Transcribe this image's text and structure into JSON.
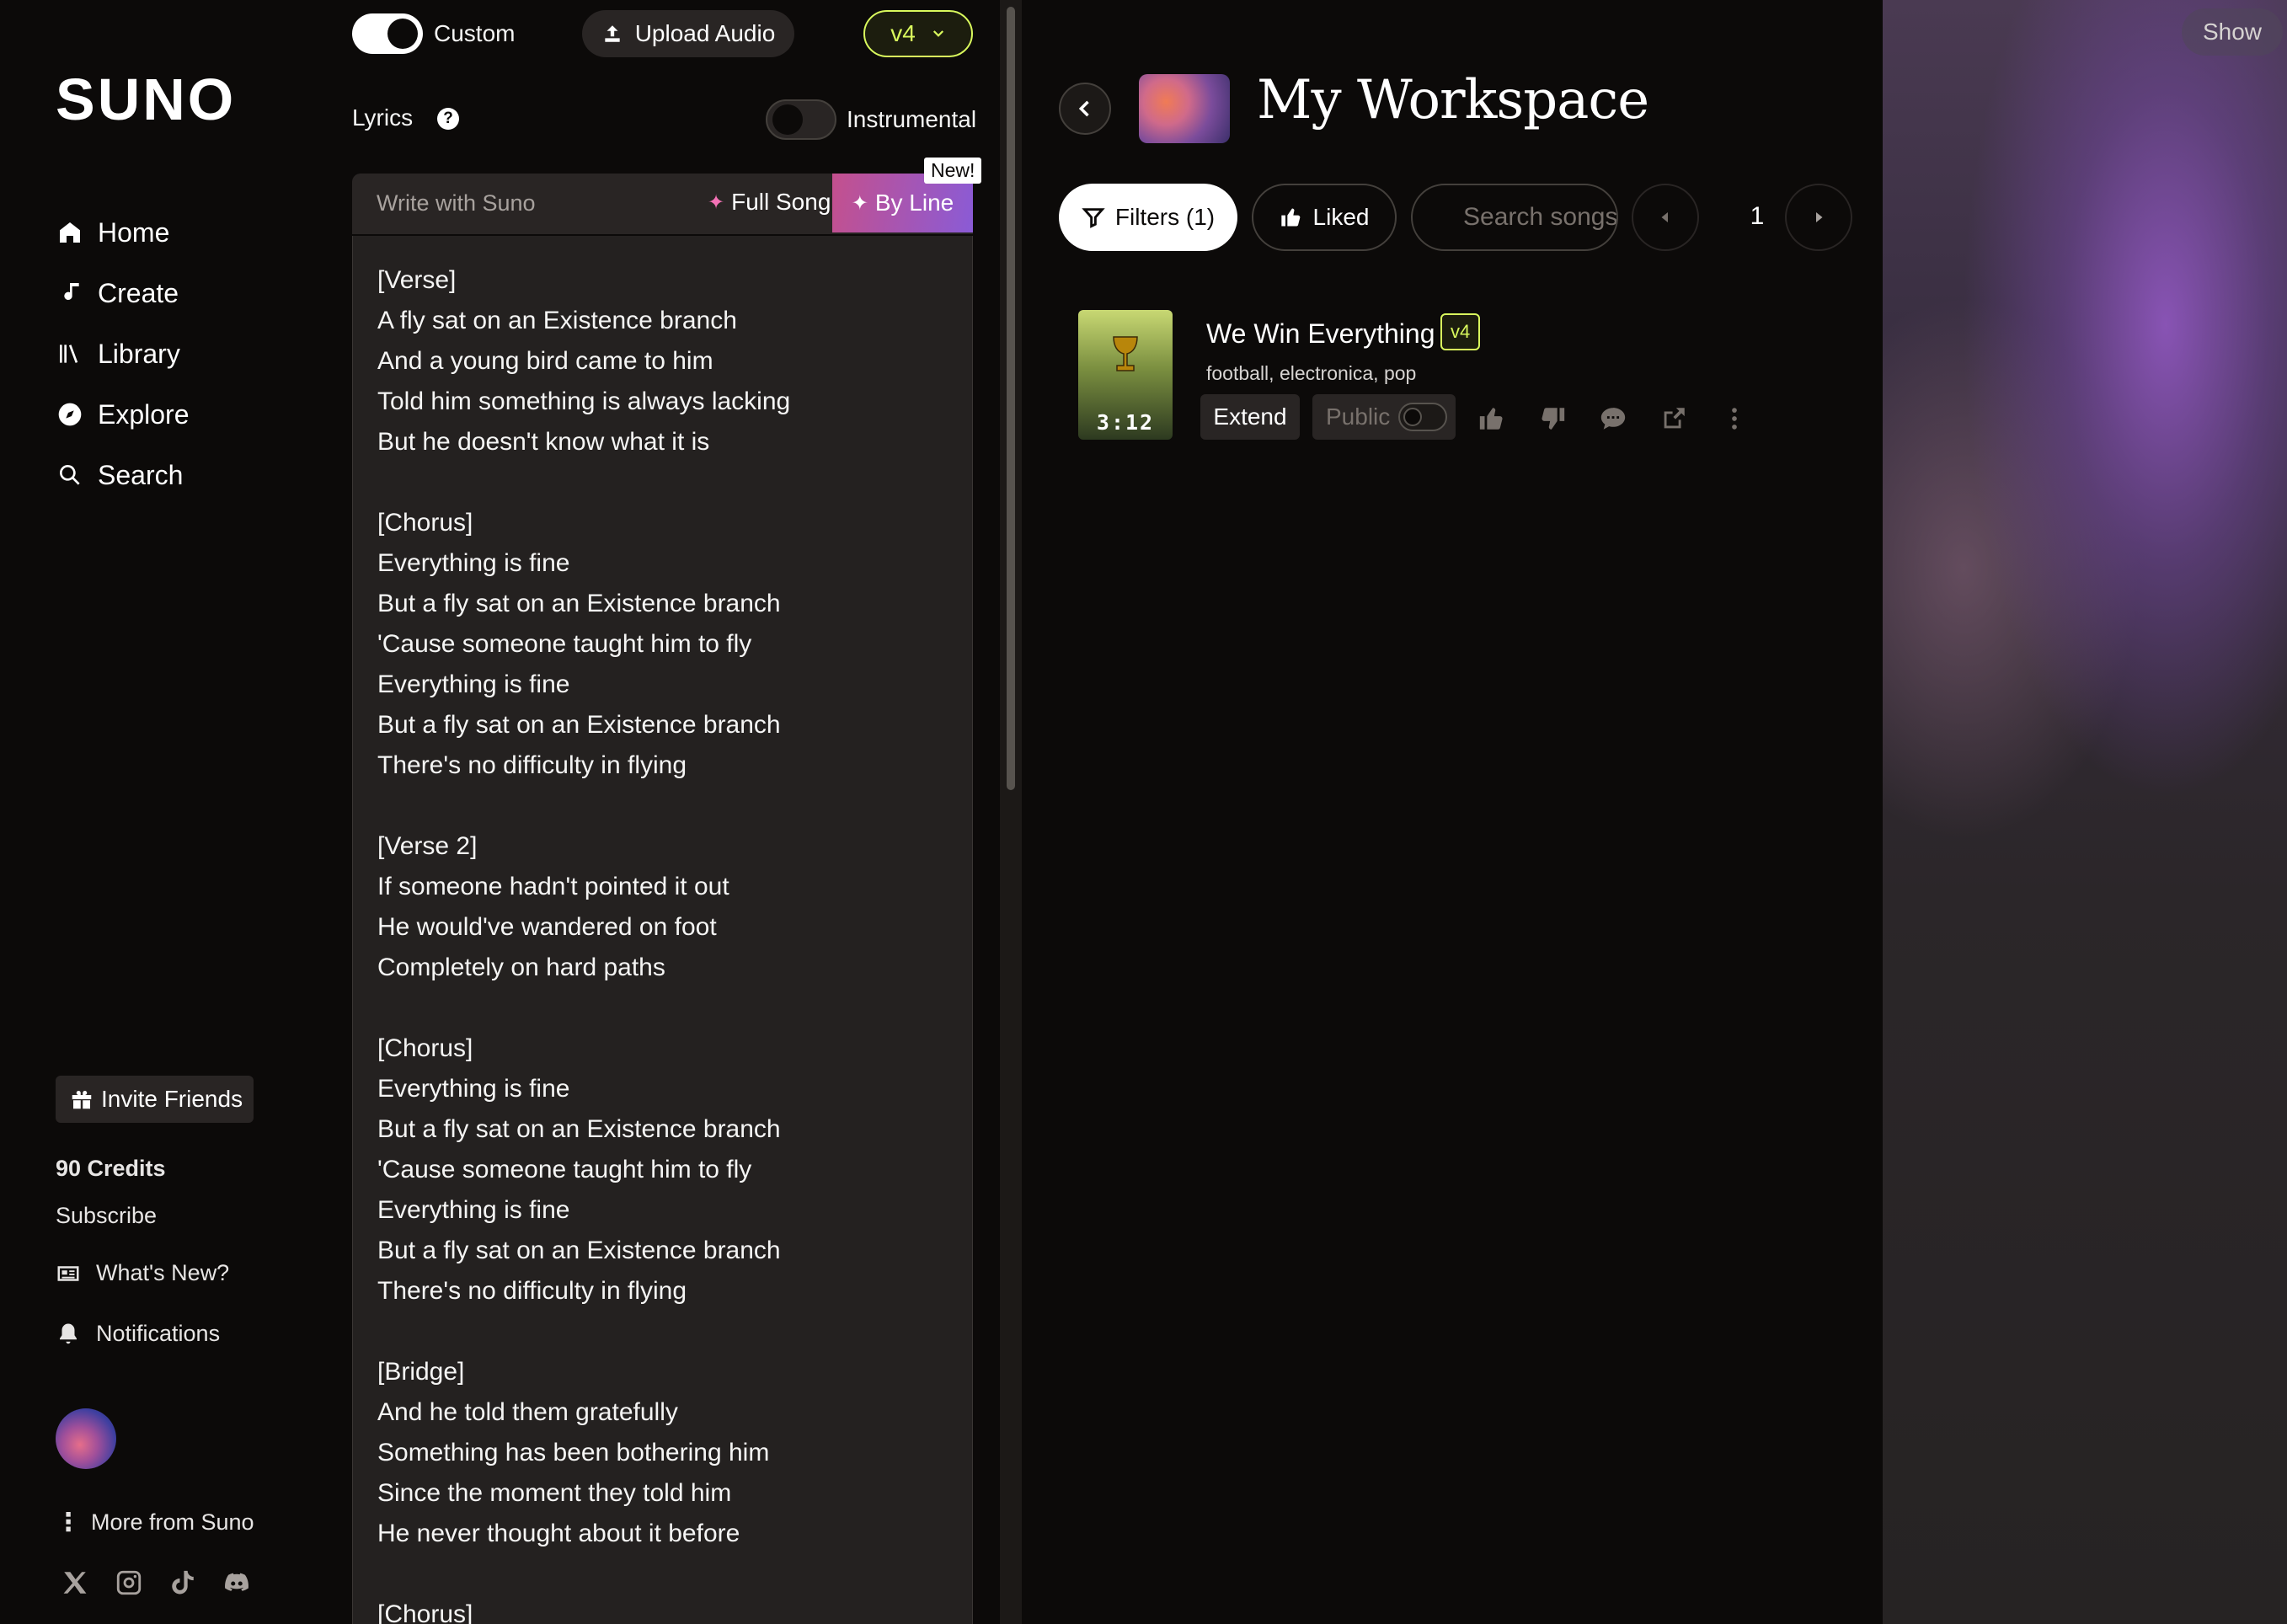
{
  "brand": {
    "logo": "SUNO"
  },
  "nav": [
    {
      "label": "Home",
      "icon": "home-icon"
    },
    {
      "label": "Create",
      "icon": "music-note-icon"
    },
    {
      "label": "Library",
      "icon": "library-icon"
    },
    {
      "label": "Explore",
      "icon": "compass-icon"
    },
    {
      "label": "Search",
      "icon": "search-icon"
    }
  ],
  "sidebar": {
    "invite": "Invite Friends",
    "credits": "90 Credits",
    "subscribe": "Subscribe",
    "whats_new": "What's New?",
    "notifications": "Notifications",
    "more": "More from Suno",
    "socials": [
      "x-icon",
      "instagram-icon",
      "tiktok-icon",
      "discord-icon"
    ]
  },
  "create": {
    "custom_label": "Custom",
    "custom_on": true,
    "upload_label": "Upload Audio",
    "version": "v4",
    "lyrics_label": "Lyrics",
    "instrumental_label": "Instrumental",
    "instrumental_on": false,
    "write_with": "Write with Suno",
    "full_song": "Full Song",
    "by_line": "By Line",
    "new_badge": "New!",
    "lyrics": [
      "[Verse]",
      "A fly sat on an Existence branch",
      "And a young bird came to him",
      "Told him something is always lacking",
      "But he doesn't know what it is",
      "",
      "[Chorus]",
      "Everything is fine",
      "But a fly sat on an Existence branch",
      "'Cause someone taught him to fly",
      "Everything is fine",
      "But a fly sat on an Existence branch",
      "There's no difficulty in flying",
      "",
      "[Verse 2]",
      "If someone hadn't pointed it out",
      "He would've wandered on foot",
      "Completely on hard paths",
      "",
      "[Chorus]",
      "Everything is fine",
      "But a fly sat on an Existence branch",
      "'Cause someone taught him to fly",
      "Everything is fine",
      "But a fly sat on an Existence branch",
      "There's no difficulty in flying",
      "",
      "[Bridge]",
      "And he told them gratefully",
      "Something has been bothering him",
      "Since the moment they told him",
      "He never thought about it before",
      "",
      "[Chorus]"
    ]
  },
  "workspace": {
    "title": "My Workspace",
    "filters_label": "Filters (1)",
    "liked_label": "Liked",
    "search_placeholder": "Search songs",
    "page": "1",
    "songs": [
      {
        "title": "We Win Everything",
        "version": "v4",
        "tags": "football, electronica, pop",
        "duration": "3:12",
        "extend_label": "Extend",
        "public_label": "Public",
        "public_on": false
      }
    ]
  },
  "deco": {
    "show_label": "Show"
  },
  "colors": {
    "accent": "#d9f95d",
    "background": "#0c0a09",
    "panel": "#292524",
    "pink": "#f472b6"
  }
}
